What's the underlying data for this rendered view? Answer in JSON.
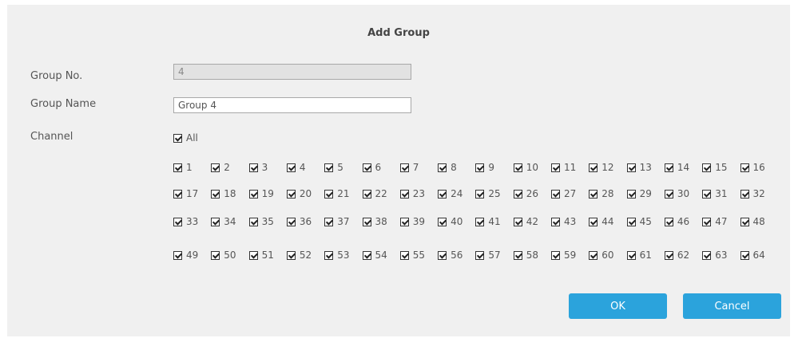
{
  "dialog": {
    "title": "Add Group",
    "group_no": {
      "label": "Group No.",
      "value": "4"
    },
    "group_name": {
      "label": "Group Name",
      "value": "Group 4"
    },
    "channel": {
      "label": "Channel",
      "all_label": "All",
      "all_checked": true,
      "channels": [
        "1",
        "2",
        "3",
        "4",
        "5",
        "6",
        "7",
        "8",
        "9",
        "10",
        "11",
        "12",
        "13",
        "14",
        "15",
        "16",
        "17",
        "18",
        "19",
        "20",
        "21",
        "22",
        "23",
        "24",
        "25",
        "26",
        "27",
        "28",
        "29",
        "30",
        "31",
        "32",
        "33",
        "34",
        "35",
        "36",
        "37",
        "38",
        "39",
        "40",
        "41",
        "42",
        "43",
        "44",
        "45",
        "46",
        "47",
        "48",
        "49",
        "50",
        "51",
        "52",
        "53",
        "54",
        "55",
        "56",
        "57",
        "58",
        "59",
        "60",
        "61",
        "62",
        "63",
        "64"
      ],
      "checked": true
    },
    "ok_label": "OK",
    "cancel_label": "Cancel"
  }
}
